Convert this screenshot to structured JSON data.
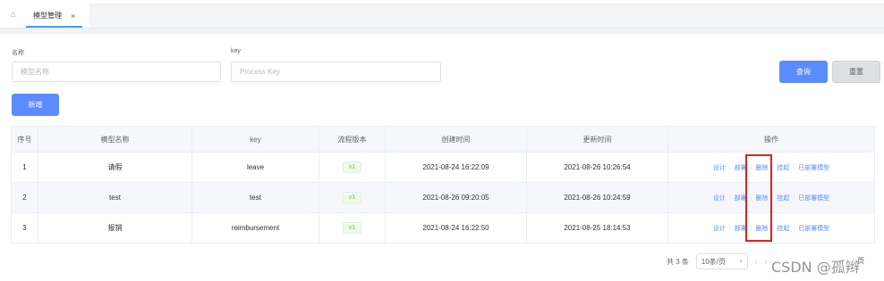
{
  "tabs": {
    "active_label": "模型管理",
    "close_glyph": "×"
  },
  "form": {
    "name_label": "名称",
    "name_placeholder": "模型名称",
    "key_label": "key",
    "key_placeholder": "Process Key",
    "query_label": "查询",
    "reset_label": "重置",
    "add_label": "新增"
  },
  "table": {
    "headers": [
      "序号",
      "模型名称",
      "key",
      "流程版本",
      "创建时间",
      "更新时间",
      "操作"
    ],
    "rows": [
      {
        "index": "1",
        "name": "请假",
        "key": "leave",
        "version": "v1",
        "created": "2021-08-24 16:22:09",
        "updated": "2021-08-26 10:26:54"
      },
      {
        "index": "2",
        "name": "test",
        "key": "test",
        "version": "v1",
        "created": "2021-08-26 09:20:05",
        "updated": "2021-08-26 10:24:59"
      },
      {
        "index": "3",
        "name": "报销",
        "key": "reimbursement",
        "version": "v1",
        "created": "2021-08-24 16:22:50",
        "updated": "2021-08-25 18:14:53"
      }
    ],
    "ops": {
      "design": "设计",
      "deploy": "部署",
      "delete": "删除",
      "suspend": "挂起",
      "deployed": "已部署模型"
    }
  },
  "pagination": {
    "total": "共 3 条",
    "page_size": "10条/页",
    "prev": "‹",
    "next": "›",
    "suffix": "页"
  },
  "watermark": "CSDN @孤辫",
  "colors": {
    "primary": "#5b8cff",
    "success": "#67c23a",
    "highlight": "#e02020"
  }
}
